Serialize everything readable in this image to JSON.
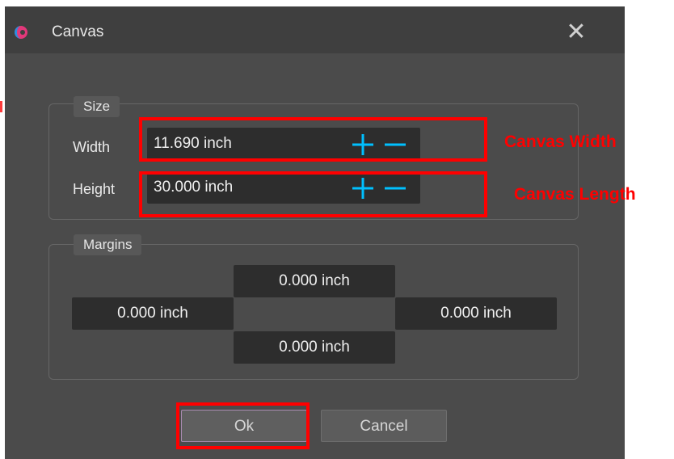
{
  "window": {
    "title": "Canvas",
    "close_glyph": "✕"
  },
  "size_group": {
    "label": "Size",
    "width_label": "Width",
    "width_value": "11.690 inch",
    "height_label": "Height",
    "height_value": "30.000 inch"
  },
  "margins_group": {
    "label": "Margins",
    "top": "0.000 inch",
    "left": "0.000 inch",
    "right": "0.000 inch",
    "bottom": "0.000 inch"
  },
  "buttons": {
    "ok": "Ok",
    "cancel": "Cancel"
  },
  "annotations": {
    "width_note": "Canvas Width",
    "height_note": "Canvas Length"
  },
  "colors": {
    "accent": "#00c0ff",
    "highlight": "#ff0000"
  }
}
